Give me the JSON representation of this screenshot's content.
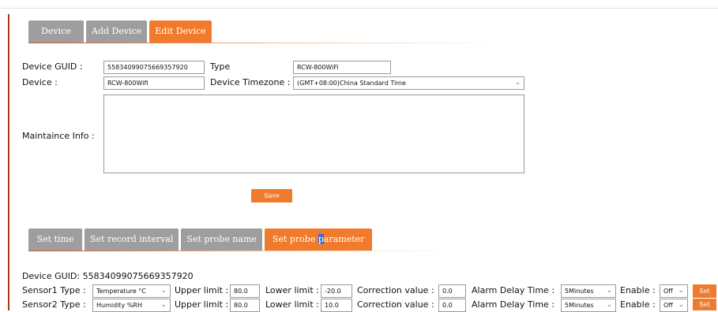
{
  "top_tabs": [
    {
      "label": "Device",
      "active": false
    },
    {
      "label": "Add Device",
      "active": false
    },
    {
      "label": "Edit Device",
      "active": true
    }
  ],
  "form": {
    "guid_label": "Device GUID :",
    "guid_value": "55834099075669357920",
    "type_label": "Type",
    "type_value": "RCW-800WiFi",
    "device_label": "Device :",
    "device_value": "RCW-800Wifi",
    "timezone_label": "Device Timezone :",
    "timezone_value": "(GMT+08:00)China Standard Time",
    "maint_label": "Maintaince Info :",
    "save_label": "Save"
  },
  "bottom_tabs": [
    {
      "label": "Set time",
      "active": false
    },
    {
      "label": "Set record interval",
      "active": false
    },
    {
      "label": "Set probe name",
      "active": false
    },
    {
      "label_pre": "Set probe ",
      "label_hl": "p",
      "label_post": "arameter",
      "active": true
    }
  ],
  "probe": {
    "guid_line": "Device GUID: 55834099075669357920",
    "sensors": [
      {
        "type_label": "Sensor1 Type :",
        "type_value": "Temperature °C",
        "upper_label": "Upper limit :",
        "upper_value": "80.0",
        "lower_label": "Lower limit :",
        "lower_value": "-20.0",
        "corr_label": "Correction value :",
        "corr_value": "0.0",
        "delay_label": "Alarm Delay Time :",
        "delay_value": "5Minutes",
        "enable_label": "Enable :",
        "enable_value": "Off",
        "set_label": "Set"
      },
      {
        "type_label": "Sensor2 Type :",
        "type_value": "Humidity %RH",
        "upper_label": "Upper limit :",
        "upper_value": "80.0",
        "lower_label": "Lower limit :",
        "lower_value": "10.0",
        "corr_label": "Correction value :",
        "corr_value": "0.0",
        "delay_label": "Alarm Delay Time :",
        "delay_value": "5Minutes",
        "enable_label": "Enable :",
        "enable_value": "Off",
        "set_label": "Set"
      }
    ]
  },
  "colors": {
    "accent": "#f07b2c",
    "tab_inactive": "#9e9e9e",
    "side_bar": "#a63a1c"
  }
}
